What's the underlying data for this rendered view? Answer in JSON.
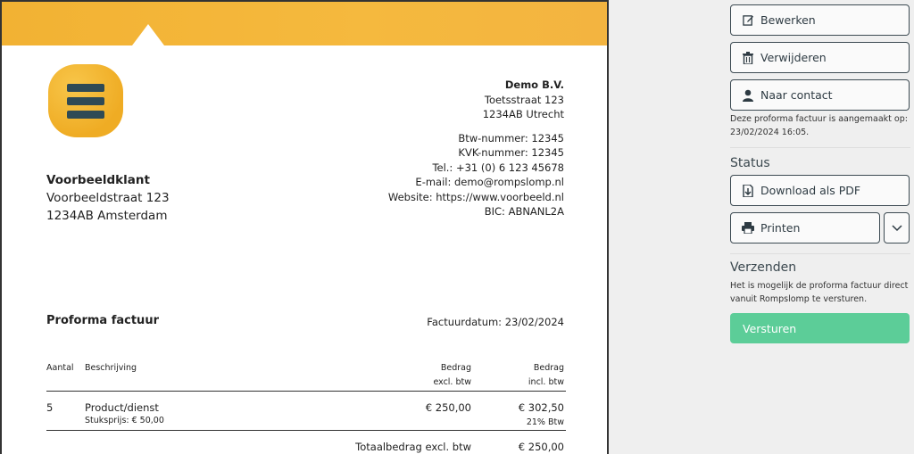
{
  "company": {
    "name": "Demo B.V.",
    "street": "Toetsstraat 123",
    "city": "1234AB Utrecht",
    "vat": "Btw-nummer: 12345",
    "kvk": "KVK-nummer: 12345",
    "phone": "Tel.: +31 (0) 6 123 45678",
    "email": "E-mail: demo@rompslomp.nl",
    "website": "Website: https://www.voorbeeld.nl",
    "bic": "BIC: ABNANL2A"
  },
  "client": {
    "name": "Voorbeeldklant",
    "street": "Voorbeeldstraat 123",
    "city": "1234AB Amsterdam"
  },
  "document": {
    "title": "Proforma factuur",
    "date": "Factuurdatum: 23/02/2024"
  },
  "table": {
    "headers": {
      "qty": "Aantal",
      "desc": "Beschrijving",
      "excl_1": "Bedrag",
      "excl_2": "excl. btw",
      "incl_1": "Bedrag",
      "incl_2": "incl. btw"
    },
    "rows": [
      {
        "qty": "5",
        "desc": "Product/dienst",
        "unit_price": "Stuksprijs: € 50,00",
        "excl": "€ 250,00",
        "incl": "€ 302,50",
        "vat": "21% Btw"
      }
    ],
    "total_label": "Totaalbedrag excl. btw",
    "total_value": "€ 250,00"
  },
  "sidebar": {
    "edit": "Bewerken",
    "delete": "Verwijderen",
    "contact": "Naar contact",
    "created_note": "Deze proforma factuur is aangemaakt op: 23/02/2024 16:05.",
    "status_heading": "Status",
    "download": "Download als PDF",
    "print": "Printen",
    "send_heading": "Verzenden",
    "send_note": "Het is mogelijk de proforma factuur direct vanuit Rompslomp te versturen.",
    "send_button": "Versturen"
  },
  "colors": {
    "banner": "#f2b233",
    "send": "#5ccd98",
    "button_border": "#3c4a52"
  }
}
